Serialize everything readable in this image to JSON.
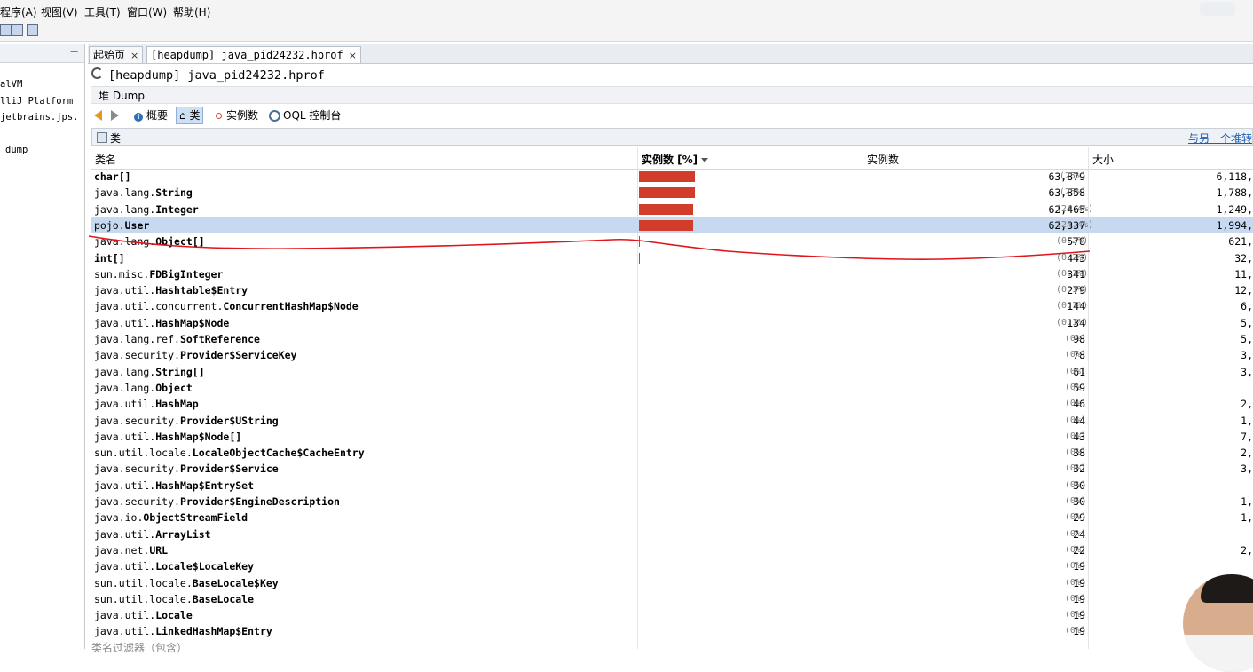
{
  "menu": [
    "程序(A)",
    "视图(V)",
    "工具(T)",
    "窗口(W)",
    "帮助(H)"
  ],
  "left_panel": {
    "collapse_symbol": "−",
    "items": [
      "alVM",
      "lliJ Platform",
      "jetbrains.jps.",
      "dump"
    ]
  },
  "tabs": [
    {
      "label": "起始页",
      "close": "×"
    },
    {
      "label": "[heapdump] java_pid24232.hprof",
      "close": "×"
    }
  ],
  "document": {
    "title": "[heapdump] java_pid24232.hprof",
    "subtitle": "堆 Dump"
  },
  "navbar": {
    "summary": "概要",
    "classes": "类",
    "instances": "实例数",
    "oql": "OQL 控制台"
  },
  "section": {
    "title": "类",
    "compare_link": "与另一个堆转"
  },
  "table": {
    "headers": {
      "name": "类名",
      "instances_pct": "实例数 [%]",
      "instances": "实例数",
      "size": "大小"
    },
    "rows": [
      {
        "pkg": "",
        "cls": "char[]",
        "count": "63,879",
        "pct": "(25%)",
        "size": "6,118,",
        "bar": 0.25
      },
      {
        "pkg": "java.lang.",
        "cls": "String",
        "count": "63,858",
        "pct": "(25%)",
        "size": "1,788,",
        "bar": 0.25
      },
      {
        "pkg": "java.lang.",
        "cls": "Integer",
        "count": "62,465",
        "pct": "(24.4%)",
        "size": "1,249,",
        "bar": 0.244
      },
      {
        "pkg": "pojo.",
        "cls": "User",
        "count": "62,337",
        "pct": "(24.4%)",
        "size": "1,994,",
        "bar": 0.244,
        "selected": true
      },
      {
        "pkg": "java.lang.",
        "cls": "Object[]",
        "count": "578",
        "pct": "(0.2%)",
        "size": "621,",
        "bar": 0.002
      },
      {
        "pkg": "",
        "cls": "int[]",
        "count": "443",
        "pct": "(0.2%)",
        "size": "32,",
        "bar": 0.002
      },
      {
        "pkg": "sun.misc.",
        "cls": "FDBigInteger",
        "count": "341",
        "pct": "(0.1%)",
        "size": "11,",
        "bar": 0
      },
      {
        "pkg": "java.util.",
        "cls": "Hashtable$Entry",
        "count": "279",
        "pct": "(0.1%)",
        "size": "12,",
        "bar": 0
      },
      {
        "pkg": "java.util.concurrent.",
        "cls": "ConcurrentHashMap$Node",
        "count": "144",
        "pct": "(0.1%)",
        "size": "6,",
        "bar": 0
      },
      {
        "pkg": "java.util.",
        "cls": "HashMap$Node",
        "count": "134",
        "pct": "(0.1%)",
        "size": "5,",
        "bar": 0
      },
      {
        "pkg": "java.lang.ref.",
        "cls": "SoftReference",
        "count": "98",
        "pct": "(0%)",
        "size": "5,",
        "bar": 0
      },
      {
        "pkg": "java.security.",
        "cls": "Provider$ServiceKey",
        "count": "78",
        "pct": "(0%)",
        "size": "3,",
        "bar": 0
      },
      {
        "pkg": "java.lang.",
        "cls": "String[]",
        "count": "61",
        "pct": "(0%)",
        "size": "3,",
        "bar": 0
      },
      {
        "pkg": "java.lang.",
        "cls": "Object",
        "count": "59",
        "pct": "(0%)",
        "size": "",
        "bar": 0
      },
      {
        "pkg": "java.util.",
        "cls": "HashMap",
        "count": "46",
        "pct": "(0%)",
        "size": "2,",
        "bar": 0
      },
      {
        "pkg": "java.security.",
        "cls": "Provider$UString",
        "count": "44",
        "pct": "(0%)",
        "size": "1,",
        "bar": 0
      },
      {
        "pkg": "java.util.",
        "cls": "HashMap$Node[]",
        "count": "43",
        "pct": "(0%)",
        "size": "7,",
        "bar": 0
      },
      {
        "pkg": "sun.util.locale.",
        "cls": "LocaleObjectCache$CacheEntry",
        "count": "38",
        "pct": "(0%)",
        "size": "2,",
        "bar": 0
      },
      {
        "pkg": "java.security.",
        "cls": "Provider$Service",
        "count": "32",
        "pct": "(0%)",
        "size": "3,",
        "bar": 0
      },
      {
        "pkg": "java.util.",
        "cls": "HashMap$EntrySet",
        "count": "30",
        "pct": "(0%)",
        "size": "",
        "bar": 0
      },
      {
        "pkg": "java.security.",
        "cls": "Provider$EngineDescription",
        "count": "30",
        "pct": "(0%)",
        "size": "1,",
        "bar": 0
      },
      {
        "pkg": "java.io.",
        "cls": "ObjectStreamField",
        "count": "29",
        "pct": "(0%)",
        "size": "1,",
        "bar": 0
      },
      {
        "pkg": "java.util.",
        "cls": "ArrayList",
        "count": "24",
        "pct": "(0%)",
        "size": "",
        "bar": 0
      },
      {
        "pkg": "java.net.",
        "cls": "URL",
        "count": "22",
        "pct": "(0%)",
        "size": "2,",
        "bar": 0
      },
      {
        "pkg": "java.util.",
        "cls": "Locale$LocaleKey",
        "count": "19",
        "pct": "(0%)",
        "size": "",
        "bar": 0
      },
      {
        "pkg": "sun.util.locale.",
        "cls": "BaseLocale$Key",
        "count": "19",
        "pct": "(0%)",
        "size": "",
        "bar": 0
      },
      {
        "pkg": "sun.util.locale.",
        "cls": "BaseLocale",
        "count": "19",
        "pct": "(0%)",
        "size": "",
        "bar": 0
      },
      {
        "pkg": "java.util.",
        "cls": "Locale",
        "count": "19",
        "pct": "(0%)",
        "size": "",
        "bar": 0
      },
      {
        "pkg": "java.util.",
        "cls": "LinkedHashMap$Entry",
        "count": "19",
        "pct": "(0%)",
        "size": "",
        "bar": 0
      }
    ]
  },
  "filter_placeholder": "类名过滤器（包含）",
  "colors": {
    "bar": "#d23c2a",
    "selected_row": "#c7d9f1",
    "annotation": "#e0141a",
    "link": "#1b5fb7"
  }
}
